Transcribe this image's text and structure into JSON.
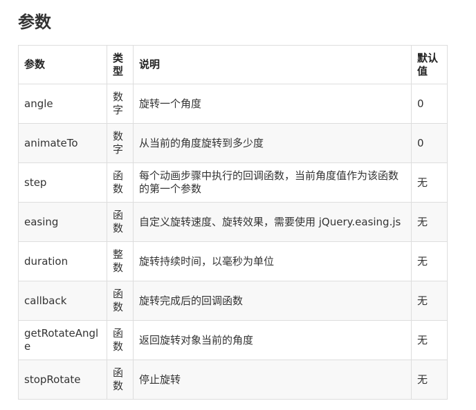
{
  "title": "参数",
  "table": {
    "headers": [
      "参数",
      "类型",
      "说明",
      "默认值"
    ],
    "rows": [
      {
        "name": "angle",
        "type": "数字",
        "desc": "旋转一个角度",
        "default": "0"
      },
      {
        "name": "animateTo",
        "type": "数字",
        "desc": "从当前的角度旋转到多少度",
        "default": "0"
      },
      {
        "name": "step",
        "type": "函数",
        "desc": "每个动画步骤中执行的回调函数，当前角度值作为该函数的第一个参数",
        "default": "无"
      },
      {
        "name": "easing",
        "type": "函数",
        "desc": "自定义旋转速度、旋转效果，需要使用 jQuery.easing.js",
        "default": "无"
      },
      {
        "name": "duration",
        "type": "整数",
        "desc": "旋转持续时间，以毫秒为单位",
        "default": "无"
      },
      {
        "name": "callback",
        "type": "函数",
        "desc": "旋转完成后的回调函数",
        "default": "无"
      },
      {
        "name": "getRotateAngle",
        "type": "函数",
        "desc": "返回旋转对象当前的角度",
        "default": "无"
      },
      {
        "name": "stopRotate",
        "type": "函数",
        "desc": "停止旋转",
        "default": "无"
      }
    ]
  }
}
